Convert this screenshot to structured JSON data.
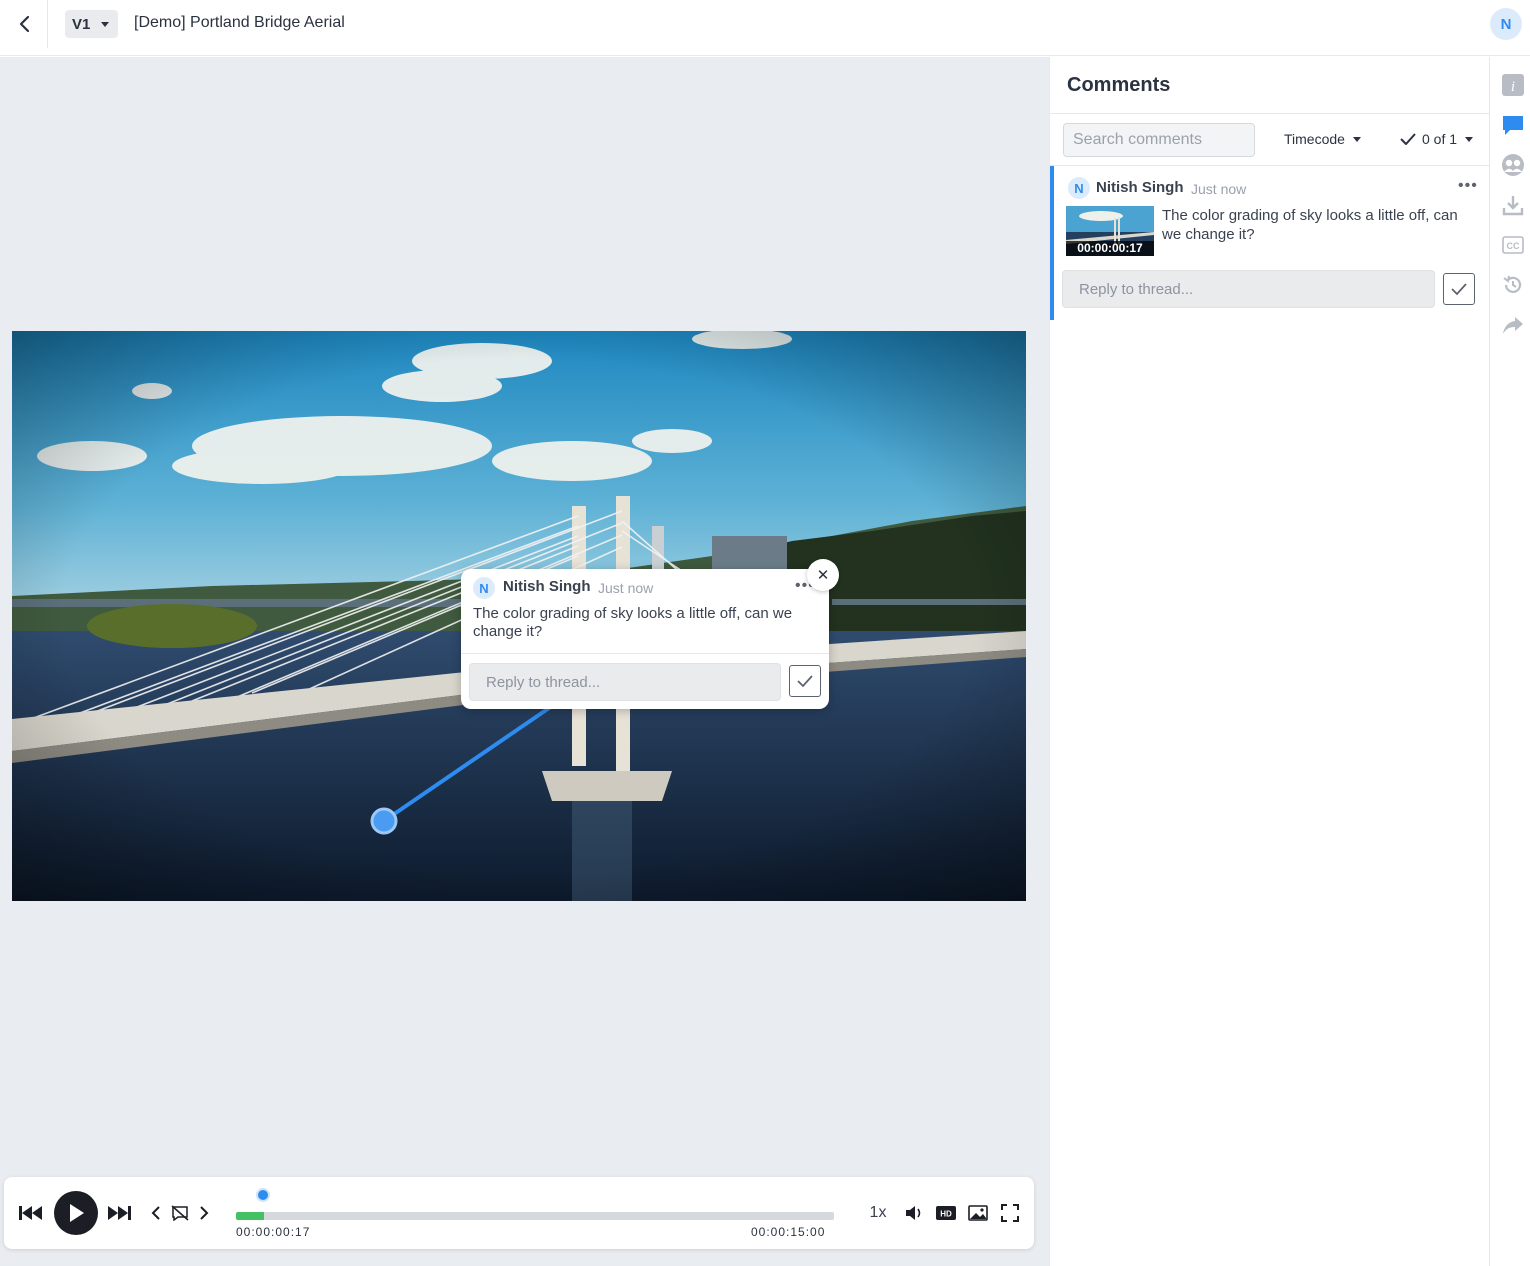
{
  "header": {
    "version_label": "V1",
    "title": "[Demo] Portland Bridge Aerial",
    "user_initial": "N"
  },
  "annotation_popup": {
    "avatar_initial": "N",
    "author": "Nitish Singh",
    "time": "Just now",
    "text": "The color grading of sky looks a little off, can we change it?",
    "reply_placeholder": "Reply to thread..."
  },
  "player": {
    "current_time": "00:00:00:17",
    "duration": "00:00:15:00",
    "speed": "1x",
    "progress_fraction": 0.047
  },
  "comments_panel": {
    "title": "Comments",
    "search_placeholder": "Search comments",
    "sort_label": "Timecode",
    "filter_label": "0 of 1",
    "threads": [
      {
        "avatar_initial": "N",
        "author": "Nitish Singh",
        "time": "Just now",
        "timecode": "00:00:00:17",
        "text": "The color grading of sky looks a little off, can we change it?",
        "reply_placeholder": "Reply to thread..."
      }
    ]
  },
  "sidebar_rail": {
    "items": [
      "info-icon",
      "comments-icon",
      "reviewers-icon",
      "download-icon",
      "captions-icon",
      "version-history-icon",
      "share-icon"
    ]
  },
  "colors": {
    "accent": "#2e8cf0",
    "progress": "#43c163",
    "stage_bg": "#e9ecf0"
  }
}
